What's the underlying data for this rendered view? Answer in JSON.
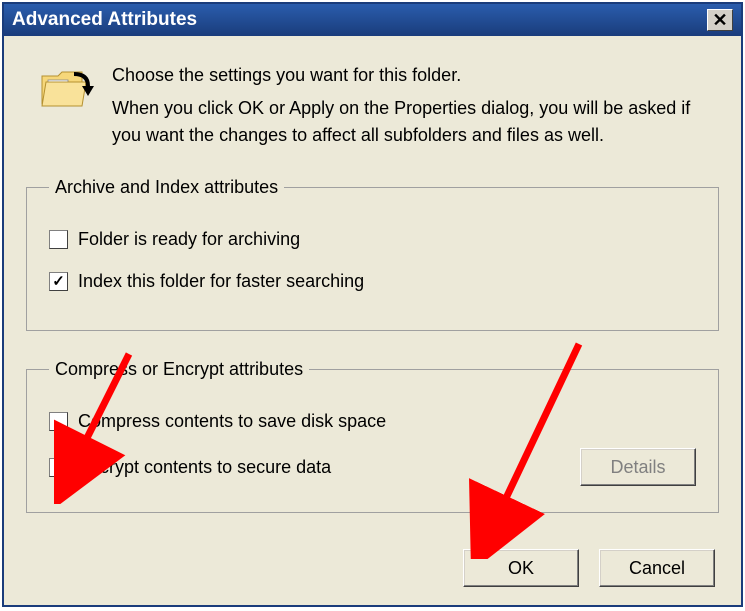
{
  "dialog": {
    "title": "Advanced Attributes",
    "close_glyph": "✕"
  },
  "intro": {
    "main": "Choose the settings you want for this folder.",
    "sub": "When you click OK or Apply on the Properties dialog, you will be asked if you want the changes to affect all subfolders and files as well."
  },
  "group1": {
    "legend": "Archive and Index attributes",
    "ready_label": "Folder is ready for archiving",
    "index_label": "Index this folder for faster searching"
  },
  "group2": {
    "legend": "Compress or Encrypt attributes",
    "compress_label": "Compress contents to save disk space",
    "encrypt_label": "Encrypt contents to secure data",
    "details_label": "Details"
  },
  "buttons": {
    "ok": "OK",
    "cancel": "Cancel"
  }
}
